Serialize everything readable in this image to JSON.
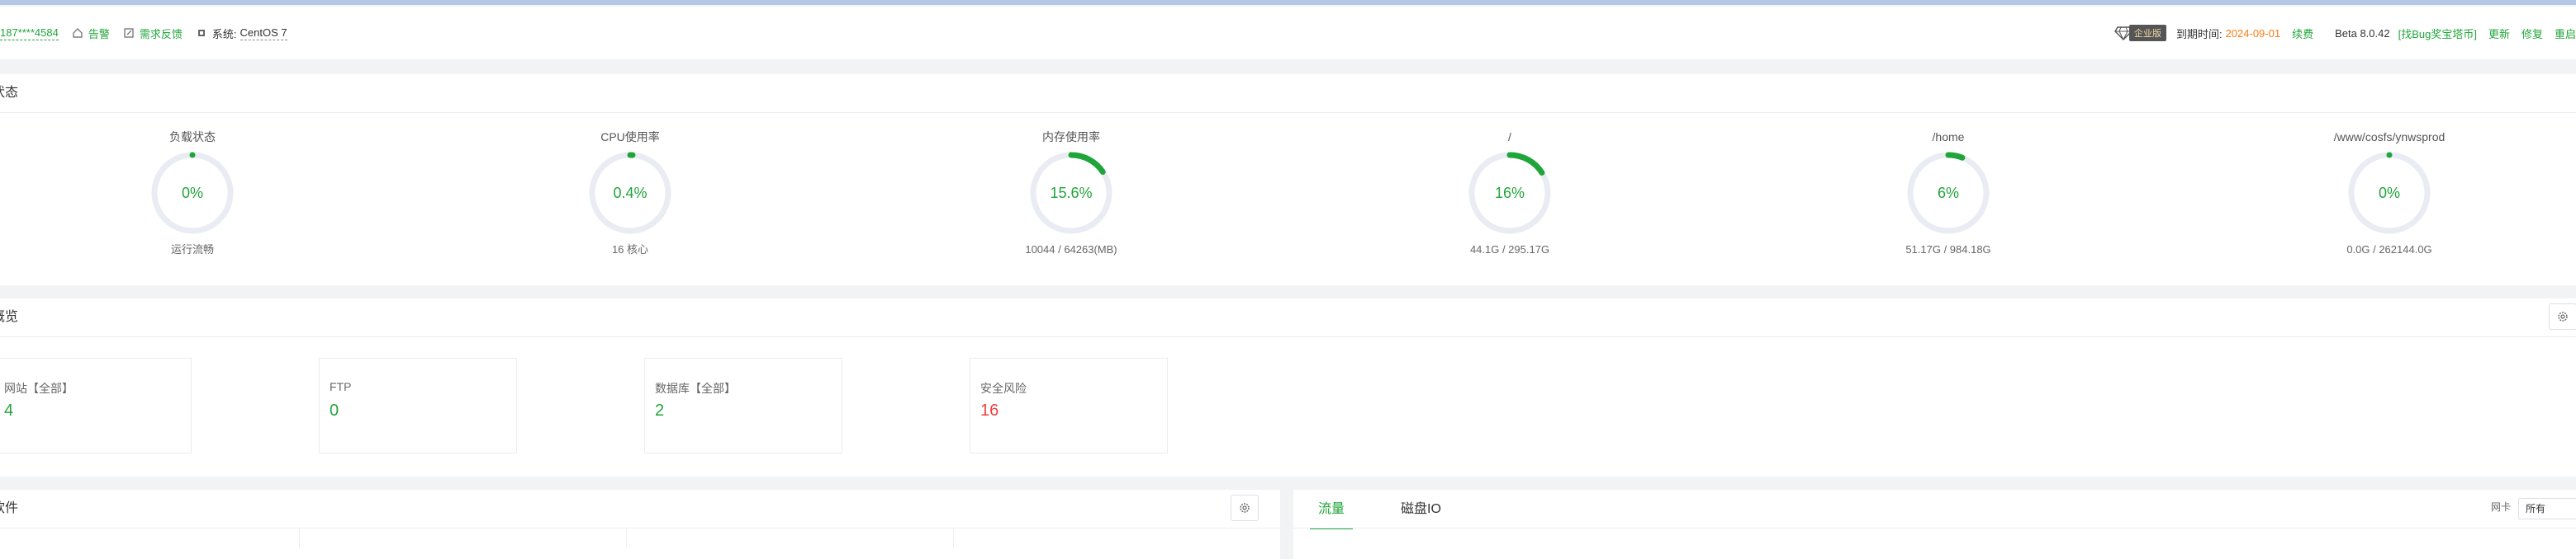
{
  "header": {
    "user": "187****4584",
    "alert_label": "告警",
    "feedback_label": "需求反馈",
    "system_label": "系统:",
    "os": "CentOS 7",
    "enterprise_badge": "企业版",
    "expiry_label": "到期时间:",
    "expiry_date": "2024-09-01",
    "renew_label": "续费",
    "version": "Beta 8.0.42",
    "bug_bounty": "[找Bug奖宝塔币]",
    "update_label": "更新",
    "repair_label": "修复",
    "restart_label": "重启"
  },
  "status": {
    "title": "状态",
    "gauges": [
      {
        "title": "负载状态",
        "value": "0%",
        "percent": 0,
        "sub": "运行流畅"
      },
      {
        "title": "CPU使用率",
        "value": "0.4%",
        "percent": 0.4,
        "sub": "16 核心"
      },
      {
        "title": "内存使用率",
        "value": "15.6%",
        "percent": 15.6,
        "sub": "10044 / 64263(MB)"
      },
      {
        "title": "/",
        "value": "16%",
        "percent": 16,
        "sub": "44.1G / 295.17G"
      },
      {
        "title": "/home",
        "value": "6%",
        "percent": 6,
        "sub": "51.17G / 984.18G"
      },
      {
        "title": "/www/cosfs/ynwsprod",
        "value": "0%",
        "percent": 0,
        "sub": "0.0G / 262144.0G"
      }
    ]
  },
  "overview": {
    "title": "概览",
    "cards": [
      {
        "label": "网站【全部】",
        "value": "4"
      },
      {
        "label": "FTP",
        "value": "0"
      },
      {
        "label": "数据库【全部】",
        "value": "2"
      },
      {
        "label": "安全风险",
        "value": "16"
      }
    ]
  },
  "software": {
    "title": "软件"
  },
  "traffic": {
    "tabs": [
      "流量",
      "磁盘IO"
    ],
    "nic_label": "网卡",
    "nic_selected": "所有"
  },
  "colors": {
    "accent": "#20a53a",
    "danger": "#ef3f3f",
    "warning": "#fa7d14",
    "track": "#e9ecf3"
  }
}
